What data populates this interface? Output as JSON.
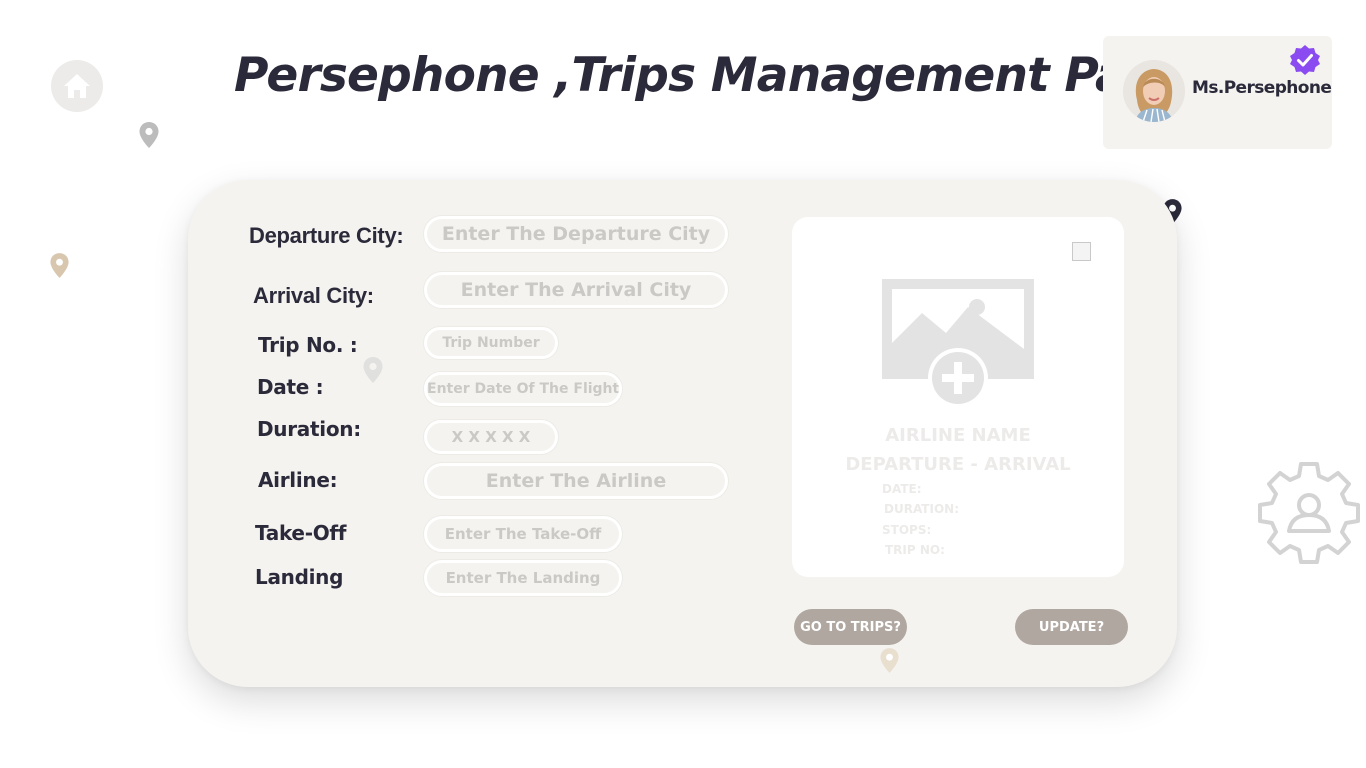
{
  "header": {
    "title": "Persephone ,Trips Management Page"
  },
  "user": {
    "name": "Ms.Persephone"
  },
  "form": {
    "departure_city": {
      "label": "Departure City:",
      "placeholder": "Enter The Departure City"
    },
    "arrival_city": {
      "label": "Arrival City:",
      "placeholder": "Enter The Arrival City"
    },
    "trip_no": {
      "label": "Trip No. :",
      "placeholder": "Trip Number"
    },
    "date": {
      "label": "Date :",
      "placeholder": "Enter Date Of The Flight"
    },
    "duration": {
      "label": "Duration:",
      "placeholder": "X X X X X"
    },
    "airline": {
      "label": "Airline:",
      "placeholder": "Enter The Airline"
    },
    "takeoff": {
      "label": "Take-Off",
      "placeholder": "Enter The Take-Off"
    },
    "landing": {
      "label": "Landing",
      "placeholder": "Enter The Landing"
    }
  },
  "preview": {
    "airline_name": "AIRLINE NAME",
    "route": "DEPARTURE - ARRIVAL",
    "date_label": "DATE:",
    "duration_label": "DURATION:",
    "stops_label": "STOPS:",
    "trip_no_label": "TRIP NO:"
  },
  "actions": {
    "go_to_trips": "GO TO TRIPS?",
    "update": "UPDATE?"
  },
  "colors": {
    "card_background": "#f5f3ef",
    "title_text": "#2b2a3a",
    "button_background": "#b0a7a1",
    "verified_badge": "#8a4cf0",
    "placeholder_text": "#cbc9c6"
  },
  "icons": [
    "home-icon",
    "location-pin-icon",
    "verified-badge-icon",
    "image-add-icon",
    "settings-user-icon"
  ]
}
